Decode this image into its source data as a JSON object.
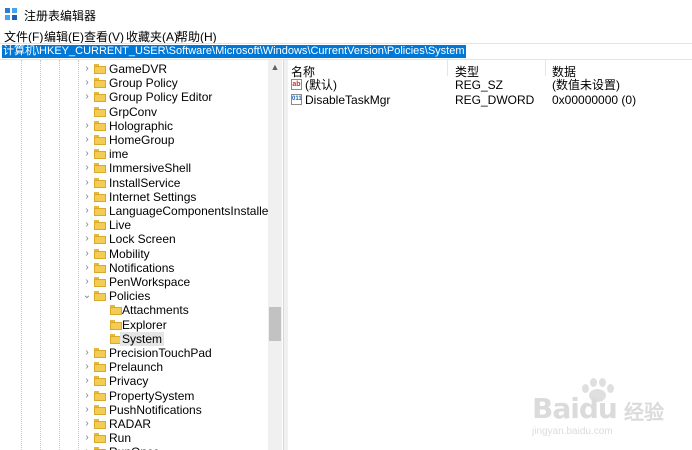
{
  "window": {
    "title": "注册表编辑器"
  },
  "menu": [
    "文件(F)",
    "编辑(E)",
    "查看(V)",
    "收藏夹(A)",
    "帮助(H)"
  ],
  "address": "计算机\\HKEY_CURRENT_USER\\Software\\Microsoft\\Windows\\CurrentVersion\\Policies\\System",
  "tree": {
    "items": [
      {
        "label": "GameDVR",
        "expand": "›",
        "selected": false
      },
      {
        "label": "Group Policy",
        "expand": "›",
        "selected": false
      },
      {
        "label": "Group Policy Editor",
        "expand": "›",
        "selected": false
      },
      {
        "label": "GrpConv",
        "expand": "",
        "selected": false
      },
      {
        "label": "Holographic",
        "expand": "›",
        "selected": false
      },
      {
        "label": "HomeGroup",
        "expand": "›",
        "selected": false
      },
      {
        "label": "ime",
        "expand": "›",
        "selected": false
      },
      {
        "label": "ImmersiveShell",
        "expand": "›",
        "selected": false
      },
      {
        "label": "InstallService",
        "expand": "›",
        "selected": false
      },
      {
        "label": "Internet Settings",
        "expand": "›",
        "selected": false
      },
      {
        "label": "LanguageComponentsInstaller",
        "expand": "›",
        "selected": false
      },
      {
        "label": "Live",
        "expand": "›",
        "selected": false
      },
      {
        "label": "Lock Screen",
        "expand": "›",
        "selected": false
      },
      {
        "label": "Mobility",
        "expand": "›",
        "selected": false
      },
      {
        "label": "Notifications",
        "expand": "›",
        "selected": false
      },
      {
        "label": "PenWorkspace",
        "expand": "›",
        "selected": false
      },
      {
        "label": "Policies",
        "expand": "⌄",
        "selected": false
      },
      {
        "label": "Attachments",
        "expand": "",
        "selected": false
      },
      {
        "label": "Explorer",
        "expand": "",
        "selected": false
      },
      {
        "label": "System",
        "expand": "",
        "selected": true
      },
      {
        "label": "PrecisionTouchPad",
        "expand": "›",
        "selected": false
      },
      {
        "label": "Prelaunch",
        "expand": "›",
        "selected": false
      },
      {
        "label": "Privacy",
        "expand": "›",
        "selected": false
      },
      {
        "label": "PropertySystem",
        "expand": "›",
        "selected": false
      },
      {
        "label": "PushNotifications",
        "expand": "›",
        "selected": false
      },
      {
        "label": "RADAR",
        "expand": "›",
        "selected": false
      },
      {
        "label": "Run",
        "expand": "›",
        "selected": false
      },
      {
        "label": "RunOnce",
        "expand": "›",
        "selected": false
      }
    ]
  },
  "values": {
    "headers": [
      "名称",
      "类型",
      "数据"
    ],
    "rows": [
      {
        "icon_text": "ab",
        "name": "(默认)",
        "type": "REG_SZ",
        "data": "(数值未设置)"
      },
      {
        "icon_text": "011",
        "name": "DisableTaskMgr",
        "type": "REG_DWORD",
        "data": "0x00000000 (0)"
      }
    ]
  },
  "watermark": {
    "brand": "Baidu",
    "cn": "经验",
    "url": "jingyan.baidu.com"
  },
  "colors": {
    "selection": "#0078d7",
    "folder": "#f4cc54"
  }
}
